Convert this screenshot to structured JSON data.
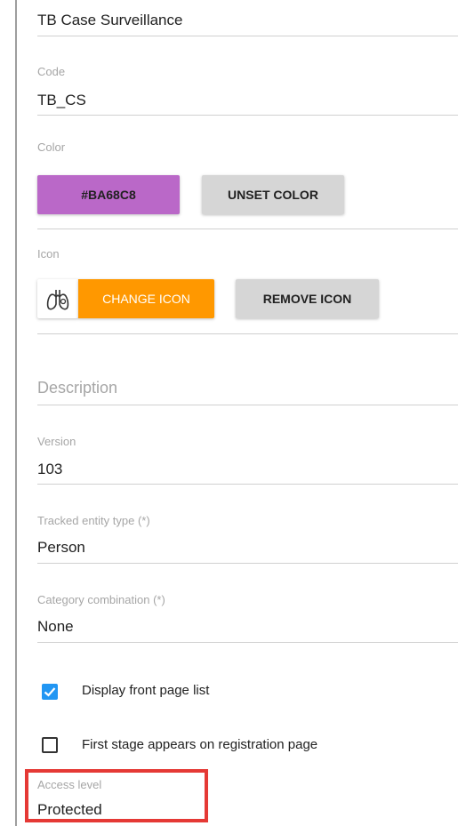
{
  "name": {
    "value": "TB Case Surveillance"
  },
  "code": {
    "label": "Code",
    "value": "TB_CS"
  },
  "color": {
    "label": "Color",
    "swatch_label": "#BA68C8",
    "swatch_color": "#BA68C8",
    "unset_label": "UNSET COLOR"
  },
  "icon": {
    "label": "Icon",
    "icon_name": "lungs-icon",
    "change_label": "CHANGE ICON",
    "change_color": "#FF9800",
    "remove_label": "REMOVE ICON"
  },
  "description": {
    "placeholder": "Description"
  },
  "version": {
    "label": "Version",
    "value": "103"
  },
  "tracked_entity_type": {
    "label": "Tracked entity type (*)",
    "value": "Person"
  },
  "category_combination": {
    "label": "Category combination (*)",
    "value": "None"
  },
  "display_front_page_list": {
    "label": "Display front page list",
    "checked": true
  },
  "first_stage_registration": {
    "label": "First stage appears on registration page",
    "checked": false
  },
  "access_level": {
    "label": "Access level",
    "value": "Protected"
  }
}
